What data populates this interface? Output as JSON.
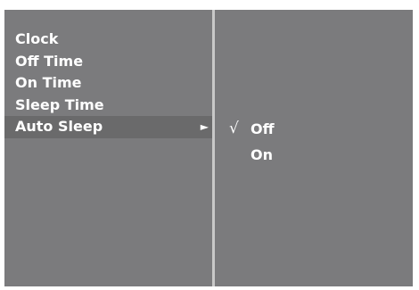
{
  "menu": {
    "items": [
      {
        "label": "Clock"
      },
      {
        "label": "Off Time"
      },
      {
        "label": "On Time"
      },
      {
        "label": "Sleep Time"
      },
      {
        "label": "Auto Sleep",
        "selected": true,
        "submenu_arrow": "►"
      }
    ]
  },
  "submenu": {
    "options": [
      {
        "label": "Off",
        "checked": true,
        "check_mark": "√"
      },
      {
        "label": "On",
        "checked": false
      }
    ]
  },
  "colors": {
    "screen_background": "#7b7b7d",
    "highlight": "#6a6a6b",
    "divider": "#c8c8c8",
    "text": "#ffffff"
  },
  "icons": {
    "submenu_arrow": "right-triangle-arrow-icon",
    "check_mark": "check-mark-icon"
  }
}
